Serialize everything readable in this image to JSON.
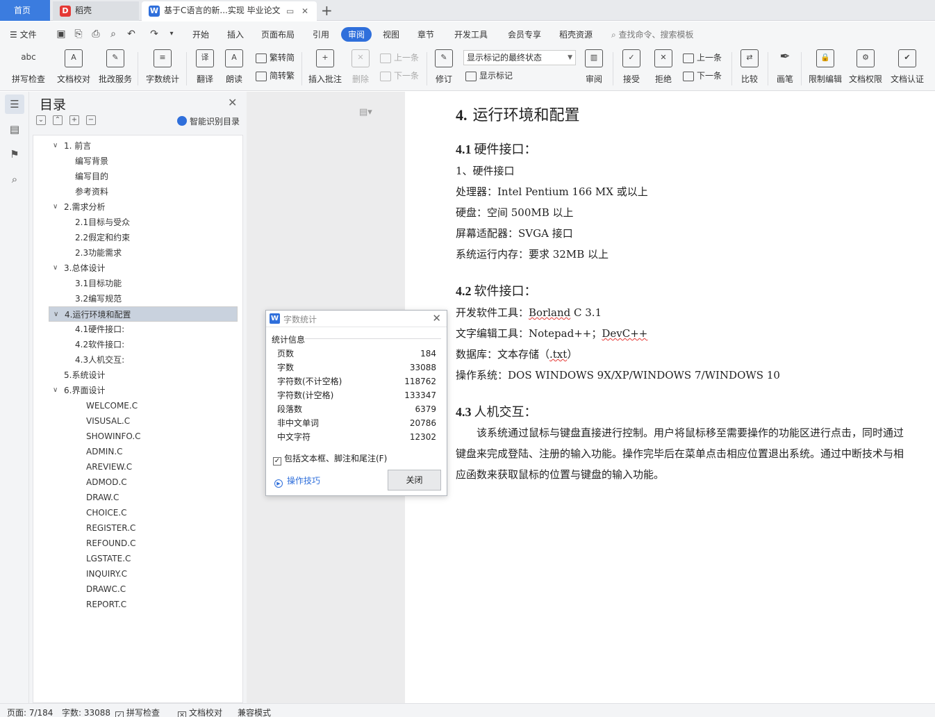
{
  "tabs": {
    "home": "首页",
    "daoke": "稻壳",
    "doc": "基于C语言的新...实现 毕业论文"
  },
  "menu": {
    "file": "文件",
    "items": [
      "开始",
      "插入",
      "页面布局",
      "引用",
      "审阅",
      "视图",
      "章节",
      "开发工具",
      "会员专享",
      "稻壳资源"
    ],
    "active": "审阅",
    "search": "查找命令、搜索模板"
  },
  "ribbon": {
    "spell": "拼写检查",
    "proof": "文档校对",
    "grade": "批改服务",
    "wordcount": "字数统计",
    "translate": "翻译",
    "read": "朗读",
    "trad": "繁转简",
    "simp": "简转繁",
    "insert_comment": "插入批注",
    "delete": "删除",
    "prev": "上一条",
    "next": "下一条",
    "track": "修订",
    "display_select": "显示标记的最终状态",
    "show_marks": "显示标记",
    "review": "审阅",
    "accept": "接受",
    "reject": "拒绝",
    "prev2": "上一条",
    "next2": "下一条",
    "compare": "比较",
    "pen": "画笔",
    "restrict": "限制编辑",
    "perm": "文档权限",
    "cert": "文档认证"
  },
  "nav": {
    "title": "目录",
    "smart": "智能识别目录",
    "toc": [
      {
        "label": "1.  前言",
        "level": 1,
        "caret": true
      },
      {
        "label": "编写背景",
        "level": 2
      },
      {
        "label": "编写目的",
        "level": 2
      },
      {
        "label": "参考资料",
        "level": 2
      },
      {
        "label": "2.需求分析",
        "level": 1,
        "caret": true
      },
      {
        "label": "2.1目标与受众",
        "level": 2
      },
      {
        "label": "2.2假定和约束",
        "level": 2
      },
      {
        "label": "2.3功能需求",
        "level": 2
      },
      {
        "label": "3.总体设计",
        "level": 1,
        "caret": true
      },
      {
        "label": "3.1目标功能",
        "level": 2
      },
      {
        "label": "3.2编写规范",
        "level": 2
      },
      {
        "label": "4.运行环境和配置",
        "level": 1,
        "caret": true,
        "selected": true
      },
      {
        "label": "4.1硬件接口:",
        "level": 2
      },
      {
        "label": "4.2软件接口:",
        "level": 2
      },
      {
        "label": "4.3人机交互:",
        "level": 2
      },
      {
        "label": "5.系统设计",
        "level": 1
      },
      {
        "label": "6.界面设计",
        "level": 1,
        "caret": true
      },
      {
        "label": "WELCOME.C",
        "level": 3
      },
      {
        "label": "VISUSAL.C",
        "level": 3
      },
      {
        "label": "SHOWINFO.C",
        "level": 3
      },
      {
        "label": "ADMIN.C",
        "level": 3
      },
      {
        "label": "AREVIEW.C",
        "level": 3
      },
      {
        "label": "ADMOD.C",
        "level": 3
      },
      {
        "label": "DRAW.C",
        "level": 3
      },
      {
        "label": "CHOICE.C",
        "level": 3
      },
      {
        "label": "REGISTER.C",
        "level": 3
      },
      {
        "label": "REFOUND.C",
        "level": 3
      },
      {
        "label": "LGSTATE.C",
        "level": 3
      },
      {
        "label": "INQUIRY.C",
        "level": 3
      },
      {
        "label": "DRAWC.C",
        "level": 3
      },
      {
        "label": "REPORT.C",
        "level": 3
      }
    ]
  },
  "doc": {
    "h1_num": "4.",
    "h1_text": "运行环境和配置",
    "h2a_num": "4.1",
    "h2a_text": "硬件接口：",
    "hw1": "1、硬件接口",
    "hw2": "处理器：Intel Pentium 166 MX 或以上",
    "hw3": "硬盘：空间 500MB 以上",
    "hw4": "屏幕适配器：SVGA 接口",
    "hw5": "系统运行内存：要求 32MB 以上",
    "h2b_num": "4.2",
    "h2b_text": "软件接口：",
    "sw1_pre": "开发软件工具：",
    "sw1_wavy": "Borland",
    "sw1_post": " C 3.1",
    "sw2_pre": "文字编辑工具：Notepad++；",
    "sw2_wavy": "DevC++",
    "sw3_pre": "数据库：文本存储（",
    "sw3_wavy": ".txt",
    "sw3_post": "）",
    "sw4": "操作系统：DOS WINDOWS 9X/XP/WINDOWS 7/WINDOWS 10",
    "h2c_num": "4.3",
    "h2c_text": "人机交互：",
    "para": "该系统通过鼠标与键盘直接进行控制。用户将鼠标移至需要操作的功能区进行点击，同时通过键盘来完成登陆、注册的输入功能。操作完毕后在菜单点击相应位置退出系统。通过中断技术与相应函数来获取鼠标的位置与键盘的输入功能。"
  },
  "dialog": {
    "title": "字数统计",
    "group": "统计信息",
    "rows": [
      {
        "label": "页数",
        "value": "184"
      },
      {
        "label": "字数",
        "value": "33088"
      },
      {
        "label": "字符数(不计空格)",
        "value": "118762"
      },
      {
        "label": "字符数(计空格)",
        "value": "133347"
      },
      {
        "label": "段落数",
        "value": "6379"
      },
      {
        "label": "非中文单词",
        "value": "20786"
      },
      {
        "label": "中文字符",
        "value": "12302"
      }
    ],
    "checkbox": "包括文本框、脚注和尾注(F)",
    "tips": "操作技巧",
    "close": "关闭"
  },
  "status": {
    "page": "页面: 7/184",
    "words": "字数: 33088",
    "spell": "拼写检查",
    "proof": "文档校对",
    "compat": "兼容模式"
  }
}
